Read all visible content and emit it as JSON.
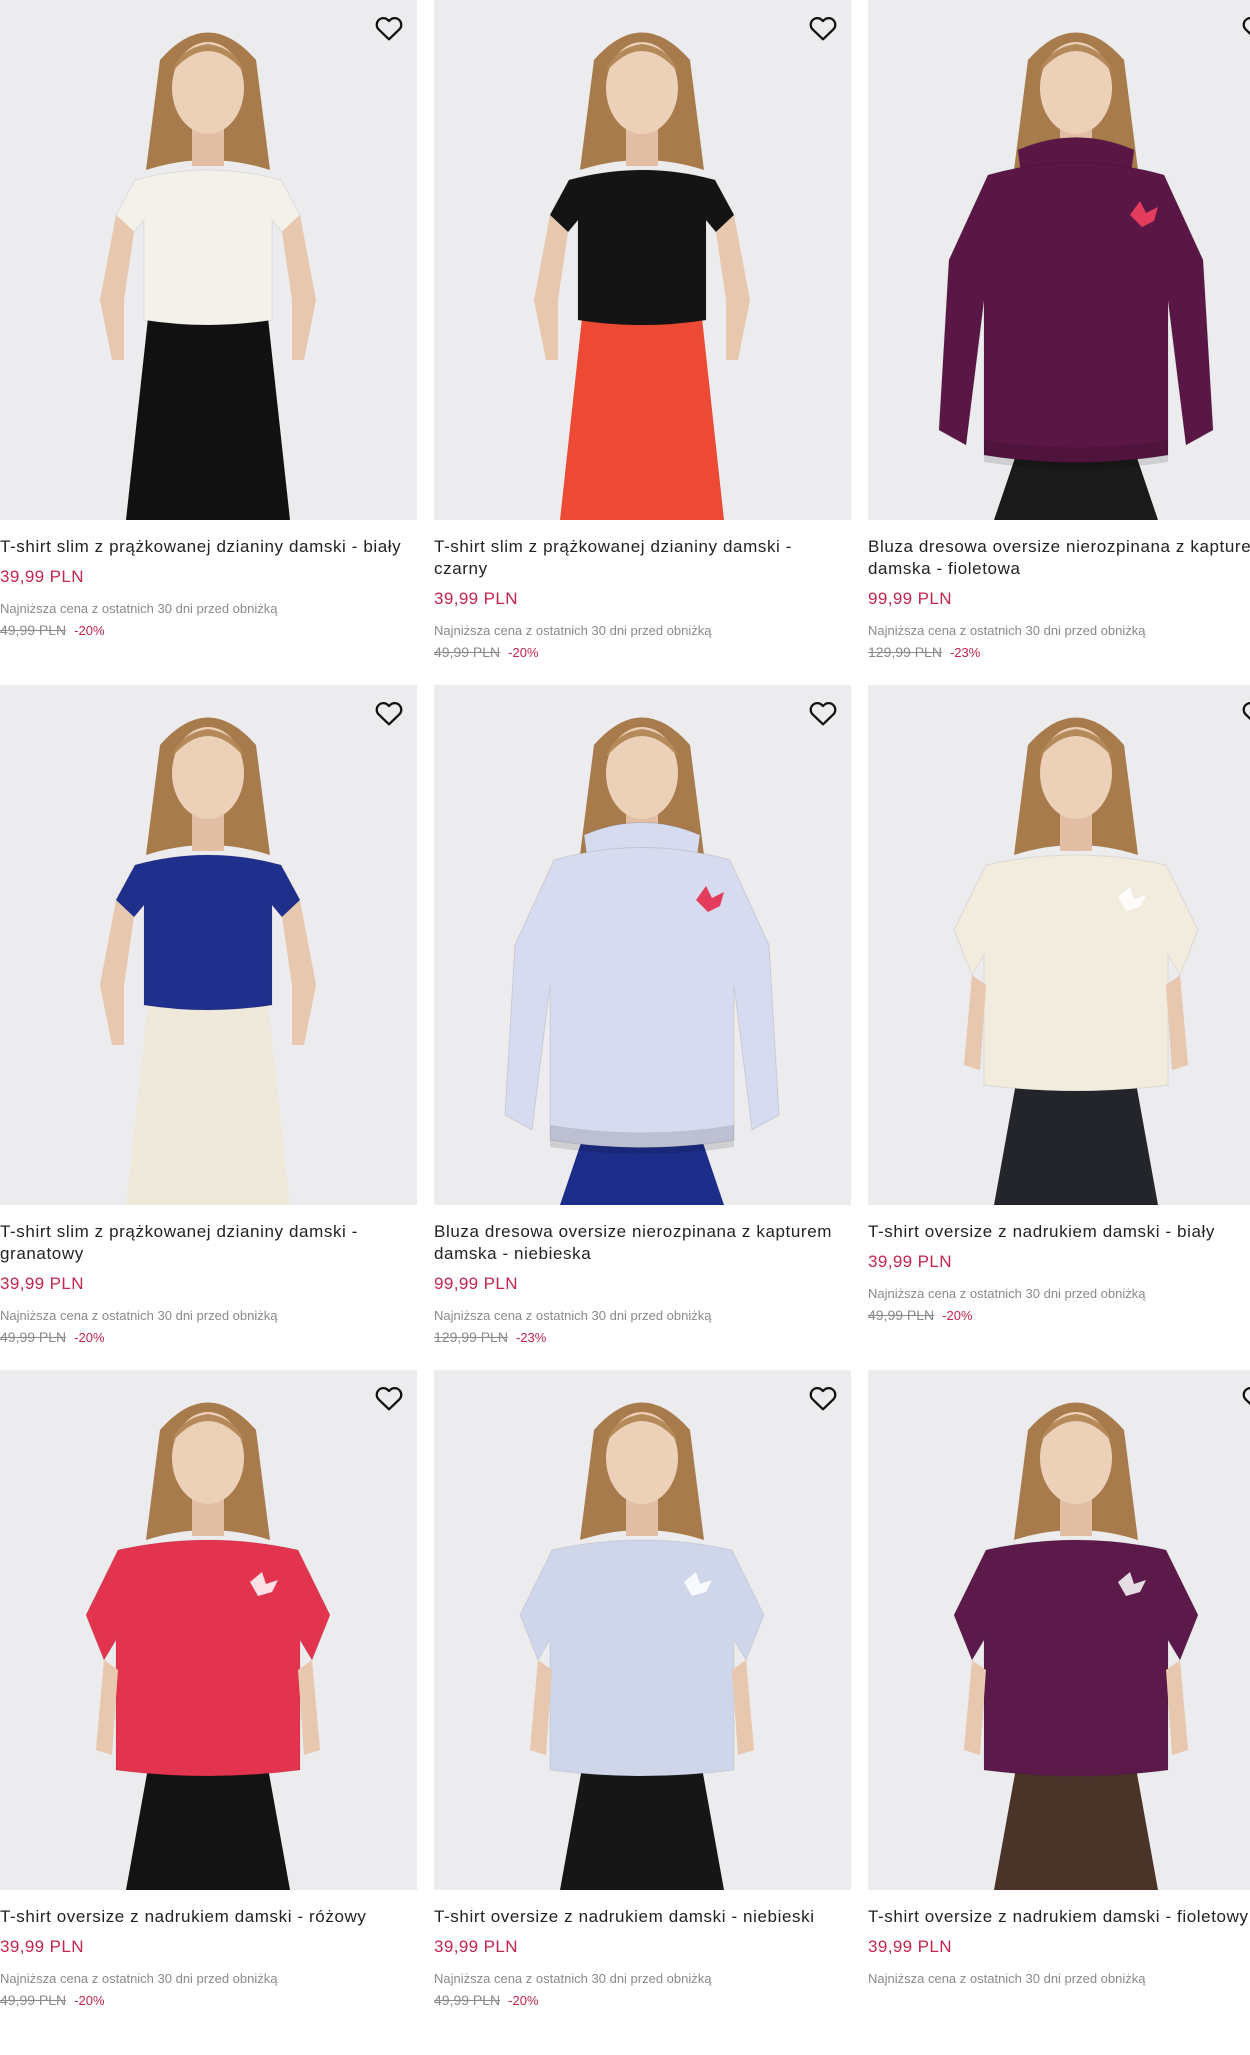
{
  "colors": {
    "price": "#c3254d",
    "photo_bg": "#ececee"
  },
  "icons": {
    "favorite": "heart-outline-icon"
  },
  "lowest_price_note": "Najniższa cena z ostatnich 30 dni przed obniżką",
  "products": [
    {
      "title": "T-shirt slim z prążkowanej dzianiny damski - biały",
      "price": "39,99 PLN",
      "lowest_label": "Najniższa cena z ostatnich 30 dni przed obniżką",
      "old_price": "49,99 PLN",
      "discount": "-20%",
      "top_color": "#f3f1ea",
      "bottom_color": "#111111",
      "garment": "tee"
    },
    {
      "title": "T-shirt slim z prążkowanej dzianiny damski - czarny",
      "price": "39,99 PLN",
      "lowest_label": "Najniższa cena z ostatnich 30 dni przed obniżką",
      "old_price": "49,99 PLN",
      "discount": "-20%",
      "top_color": "#141414",
      "bottom_color": "#ec4a34",
      "garment": "tee"
    },
    {
      "title": "Bluza dresowa oversize nierozpinana z kapturem damska - fioletowa",
      "price": "99,99 PLN",
      "lowest_label": "Najniższa cena z ostatnich 30 dni przed obniżką",
      "old_price": "129,99 PLN",
      "discount": "-23%",
      "top_color": "#5a1645",
      "bottom_color": "#1a1a1a",
      "garment": "hoodie"
    },
    {
      "title": "T-shirt slim z prążkowanej dzianiny damski - granatowy",
      "price": "39,99 PLN",
      "lowest_label": "Najniższa cena z ostatnich 30 dni przed obniżką",
      "old_price": "49,99 PLN",
      "discount": "-20%",
      "top_color": "#1f2f8c",
      "bottom_color": "#efe9dc",
      "garment": "tee"
    },
    {
      "title": "Bluza dresowa oversize nierozpinana z kapturem damska - niebieska",
      "price": "99,99 PLN",
      "lowest_label": "Najniższa cena z ostatnich 30 dni przed obniżką",
      "old_price": "129,99 PLN",
      "discount": "-23%",
      "top_color": "#d7dbef",
      "bottom_color": "#1d2d8a",
      "garment": "hoodie"
    },
    {
      "title": "T-shirt oversize z nadrukiem damski - biały",
      "price": "39,99 PLN",
      "lowest_label": "Najniższa cena z ostatnich 30 dni przed obniżką",
      "old_price": "49,99 PLN",
      "discount": "-20%",
      "top_color": "#f1ecdd",
      "bottom_color": "#23252b",
      "garment": "oversize"
    },
    {
      "title": "T-shirt oversize z nadrukiem damski - różowy",
      "price": "39,99 PLN",
      "lowest_label": "Najniższa cena z ostatnich 30 dni przed obniżką",
      "old_price": "49,99 PLN",
      "discount": "-20%",
      "top_color": "#e2344f",
      "bottom_color": "#131313",
      "garment": "oversize"
    },
    {
      "title": "T-shirt oversize z nadrukiem damski - niebieski",
      "price": "39,99 PLN",
      "lowest_label": "Najniższa cena z ostatnich 30 dni przed obniżką",
      "old_price": "49,99 PLN",
      "discount": "-20%",
      "top_color": "#cfd6ea",
      "bottom_color": "#161616",
      "garment": "oversize"
    },
    {
      "title": "T-shirt oversize z nadrukiem damski - fioletowy",
      "price": "39,99 PLN",
      "lowest_label": "Najniższa cena z ostatnich 30 dni przed obniżką",
      "old_price": "",
      "discount": "",
      "top_color": "#5b1a4a",
      "bottom_color": "#4a3329",
      "garment": "oversize"
    }
  ]
}
